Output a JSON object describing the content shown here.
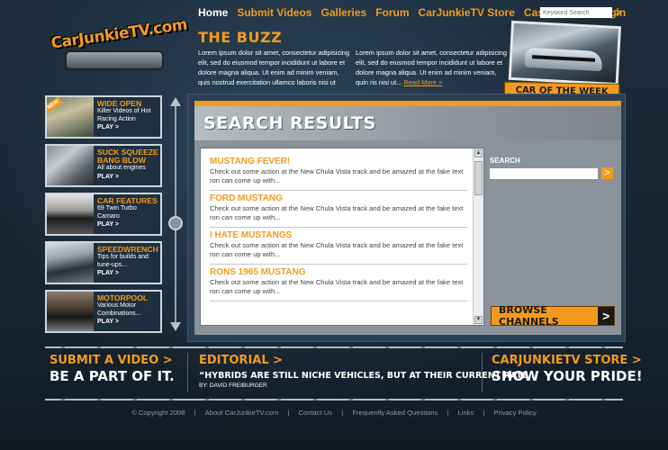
{
  "nav": {
    "items": [
      "Home",
      "Submit Videos",
      "Galleries",
      "Forum",
      "CarJunkieTV Store",
      "Cast & Crew",
      "Login"
    ],
    "active": "Home",
    "search_placeholder": "Keyword Search",
    "search_go": ">"
  },
  "logo": {
    "text": "CarJunkieTV.com"
  },
  "buzz": {
    "title": "THE BUZZ",
    "col1": "Lorem ipsum dolor sit amet, consectetur adipisicing elit, sed do eiusmod tempor incididunt ut labore et dolore magna aliqua. Ut enim ad minim veniam, quis nostrud exercitation ullamco laboris nisi ut",
    "col2": "Lorem ipsum dolor sit amet, consectetur adipisicing elit, sed do eiusmod tempor incididunt ut labore et dolore magna aliqua. Ut enim ad minim veniam, quin ris nisi ut...",
    "read_more": "Read More >"
  },
  "car_of_week": {
    "label": "CAR OF THE WEEK"
  },
  "sidebar": {
    "new_badge": "NEW",
    "items": [
      {
        "title": "WIDE OPEN",
        "desc": "Killer Videos of Hot Racing Action",
        "play": "PLAY >"
      },
      {
        "title": "SUCK SQUEEZE BANG BLOW",
        "desc": "All about engines",
        "play": "PLAY >"
      },
      {
        "title": "CAR FEATURES",
        "desc": "69 Twin Turbo Camaro",
        "play": "PLAY >"
      },
      {
        "title": "SPEEDWRENCH",
        "desc": "Tips for builds and tune-ups...",
        "play": "PLAY >"
      },
      {
        "title": "MOTORPOOL",
        "desc": "Various Motor Combinations...",
        "play": "PLAY >"
      }
    ]
  },
  "search_results": {
    "title": "SEARCH RESULTS",
    "results": [
      {
        "title": "MUSTANG FEVER!",
        "desc": "Check out some action at the New Chula Vista track and be amazed at the fake text ron can come up with..."
      },
      {
        "title": "FORD MUSTANG",
        "desc": "Check out some action at the New Chula Vista track and be amazed at the fake text ron can come up with..."
      },
      {
        "title": "I HATE MUSTANGS",
        "desc": "Check out some action at the New Chula Vista track and be amazed at the fake text ron can come up with..."
      },
      {
        "title": "RONS 1965 MUSTANG",
        "desc": "Check out some action at the New Chula Vista track and be amazed at the fake text ron can come up with..."
      }
    ],
    "search_label": "SEARCH",
    "search_go": ">",
    "browse_label": "BROWSE CHANNELS",
    "browse_arrow": ">"
  },
  "promos": {
    "submit": {
      "heading": "SUBMIT A VIDEO >",
      "sub": "BE A PART OF IT."
    },
    "editorial": {
      "heading": "EDITORIAL >",
      "quote": "“HYBRIDS ARE STILL NICHE VEHICLES, BUT AT THEIR CURRENT RATE...",
      "byline": "BY: DAVID FREIBURGER"
    },
    "store": {
      "heading": "CARJUNKIETV STORE >",
      "sub": "SHOW YOUR PRIDE!"
    }
  },
  "footer": {
    "copyright": "© Copyright 2008",
    "links": [
      "About CarJunkieTV.com",
      "Contact Us",
      "Frequently Asked Questions",
      "Links",
      "Privacy Policy"
    ],
    "separator": "|"
  },
  "colors": {
    "accent": "#f39b1c",
    "background": "#14202b",
    "panel": "#8c9299"
  }
}
